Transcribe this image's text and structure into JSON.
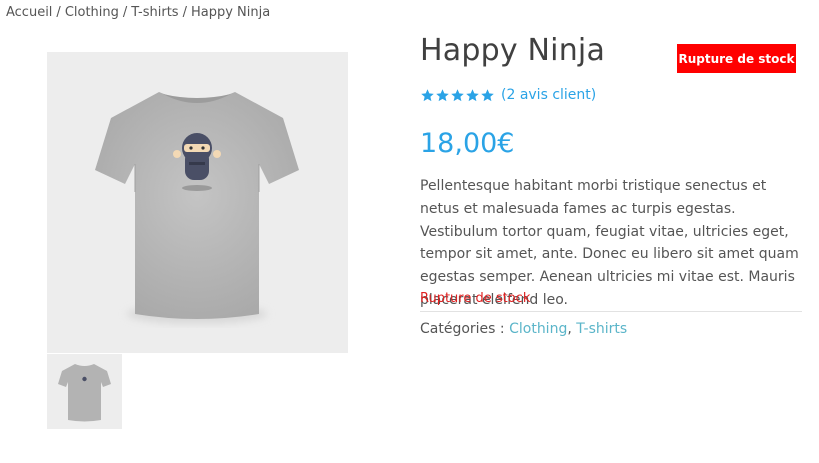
{
  "breadcrumb": {
    "items": [
      "Accueil",
      "Clothing",
      "T-shirts",
      "Happy Ninja"
    ],
    "separator": "/"
  },
  "product": {
    "title": "Happy Ninja",
    "stock_badge": "Rupture de stock",
    "rating": {
      "stars": 5,
      "max": 5,
      "review_link": "(2 avis client)"
    },
    "price": "18,00€",
    "description": "Pellentesque habitant morbi tristique senectus et netus et malesuada fames ac turpis egestas. Vestibulum tortor quam, feugiat vitae, ultricies eget, tempor sit amet, ante. Donec eu libero sit amet quam egestas semper. Aenean ultricies mi vitae est. Mauris placerat eleifend leo.",
    "stock_status": "Rupture de stock",
    "categories_label": "Catégories :",
    "categories": [
      "Clothing",
      "T-shirts"
    ],
    "category_separator": ","
  },
  "images": {
    "main": "tshirt-ninja-image",
    "thumbnail": "tshirt-thumbnail-image"
  },
  "colors": {
    "accent": "#2aa3e6",
    "badge": "#ff0000",
    "out_of_stock": "#e02020",
    "link": "#5bb5c9"
  }
}
